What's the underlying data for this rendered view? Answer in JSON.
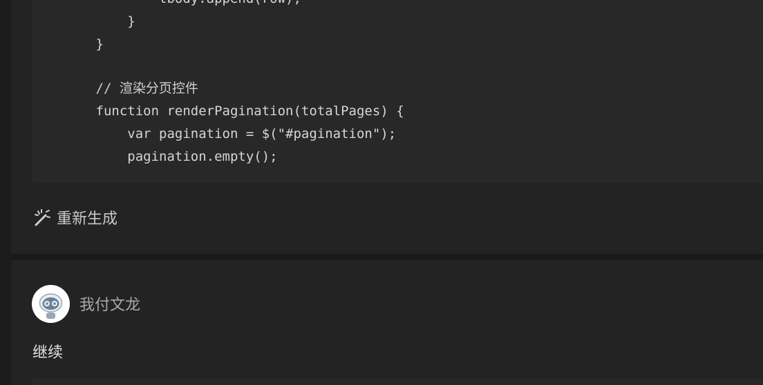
{
  "code_block": {
    "lines": [
      {
        "text": "                tbody.append(row);",
        "kind": "code"
      },
      {
        "text": "            }",
        "kind": "code"
      },
      {
        "text": "        }",
        "kind": "code"
      },
      {
        "text": "",
        "kind": "blank"
      },
      {
        "text": "        // 渲染分页控件",
        "kind": "comment"
      },
      {
        "text": "        function renderPagination(totalPages) {",
        "kind": "code"
      },
      {
        "text": "            var pagination = $(\"#pagination\");",
        "kind": "code"
      },
      {
        "text": "            pagination.empty();",
        "kind": "code"
      }
    ]
  },
  "actions": {
    "regenerate_label": "重新生成",
    "regenerate_icon": "magic-wand-icon"
  },
  "user_message": {
    "avatar_icon": "robot-avatar-icon",
    "username": "我付文龙",
    "text": "继续"
  },
  "colors": {
    "background": "#202020",
    "panel": "#232323",
    "code_background": "#282828",
    "code_text": "#d6d6d6",
    "muted_text": "#a9a9a9"
  }
}
